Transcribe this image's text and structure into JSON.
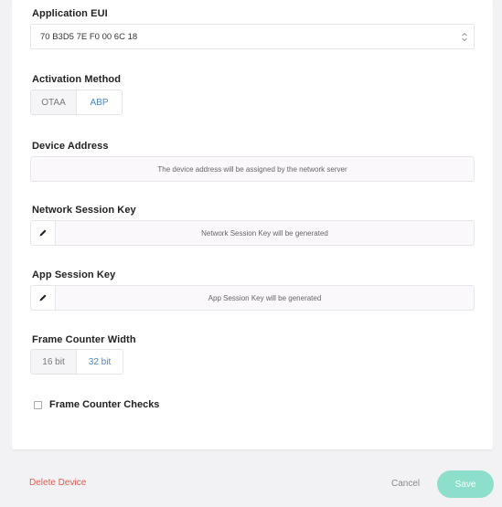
{
  "application_eui": {
    "label": "Application EUI",
    "value": "70 B3D5 7E F0 00 6C 18",
    "icon": "chevron-updown-icon"
  },
  "activation_method": {
    "label": "Activation Method",
    "options": [
      "OTAA",
      "ABP"
    ],
    "selected": "ABP"
  },
  "device_address": {
    "label": "Device Address",
    "text": "The device address will be assigned by the network server"
  },
  "network_session_key": {
    "label": "Network Session Key",
    "text": "Network Session Key will be generated",
    "icon": "pencil-icon"
  },
  "app_session_key": {
    "label": "App Session Key",
    "text": "App Session Key will be generated",
    "icon": "pencil-icon"
  },
  "frame_counter_width": {
    "label": "Frame Counter Width",
    "options": [
      "16 bit",
      "32 bit"
    ],
    "selected": "32 bit"
  },
  "frame_counter_checks": {
    "label": "Frame Counter Checks",
    "checked": false
  },
  "footer": {
    "delete_label": "Delete Device",
    "cancel_label": "Cancel",
    "save_label": "Save"
  },
  "colors": {
    "accent_blue": "#4a86c8",
    "danger": "#e05a4f",
    "save_button": "#8ddfcb"
  }
}
